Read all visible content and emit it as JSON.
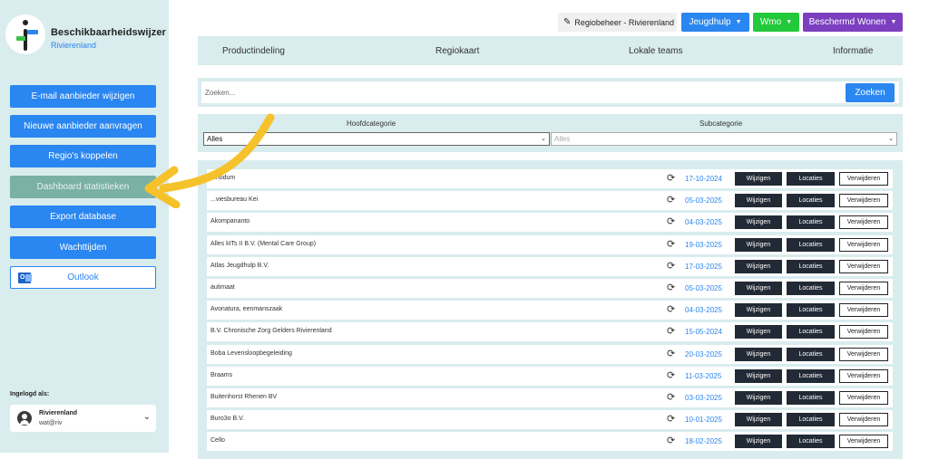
{
  "brand": {
    "title": "Beschikbaarheidswijzer",
    "subtitle": "Rivierenland"
  },
  "sidebar": {
    "buttons": [
      {
        "label": "E-mail aanbieder wijzigen"
      },
      {
        "label": "Nieuwe aanbieder aanvragen"
      },
      {
        "label": "Regio's koppelen"
      },
      {
        "label": "Dashboard statistieken"
      },
      {
        "label": "Export database"
      },
      {
        "label": "Wachttijden"
      },
      {
        "label": "Outlook"
      }
    ],
    "logged_in_label": "Ingelogd als:",
    "user": {
      "name": "Rivierenland",
      "email": "wat@riv"
    }
  },
  "topbar": {
    "regiobeheer": "Regiobeheer - Rivierenland",
    "jeugdhulp": "Jeugdhulp",
    "wmo": "Wmo",
    "beschermd": "Beschermd Wonen",
    "colors": {
      "jeugdhulp": "#2a86f0",
      "wmo": "#22c93a",
      "beschermd": "#7b3fbf"
    }
  },
  "nav": {
    "items": [
      "Productindeling",
      "Regiokaart",
      "Lokale teams",
      "Informatie"
    ]
  },
  "search": {
    "placeholder": "Zoeken...",
    "button": "Zoeken"
  },
  "filters": {
    "main_label": "Hoofdcategorie",
    "sub_label": "Subcategorie",
    "main_value": "Alles",
    "sub_value": "Alles"
  },
  "row_buttons": {
    "edit": "Wijzigen",
    "locations": "Locaties",
    "delete": "Verwijderen"
  },
  "providers": [
    {
      "name": "...nodum",
      "date": "17-10-2024"
    },
    {
      "name": "...viesbureau Kei",
      "date": "05-03-2025"
    },
    {
      "name": "Akompananto",
      "date": "04-03-2025"
    },
    {
      "name": "Alles kITs II B.V. (Mental Care Group)",
      "date": "19-03-2025"
    },
    {
      "name": "Atlas Jeugdhulp B.V.",
      "date": "17-03-2025"
    },
    {
      "name": "autimaat",
      "date": "05-03-2025"
    },
    {
      "name": "Avonatura, eenmanszaak",
      "date": "04-03-2025"
    },
    {
      "name": "B.V. Chronische Zorg Gelders Rivierenland",
      "date": "15-05-2024"
    },
    {
      "name": "Boba Levensloopbegeleiding",
      "date": "20-03-2025"
    },
    {
      "name": "Braams",
      "date": "11-03-2025"
    },
    {
      "name": "Buitenhorst Rhenen BV",
      "date": "03-03-2025"
    },
    {
      "name": "Buro3o B.V.",
      "date": "10-01-2025"
    },
    {
      "name": "Cello",
      "date": "18-02-2025"
    }
  ]
}
